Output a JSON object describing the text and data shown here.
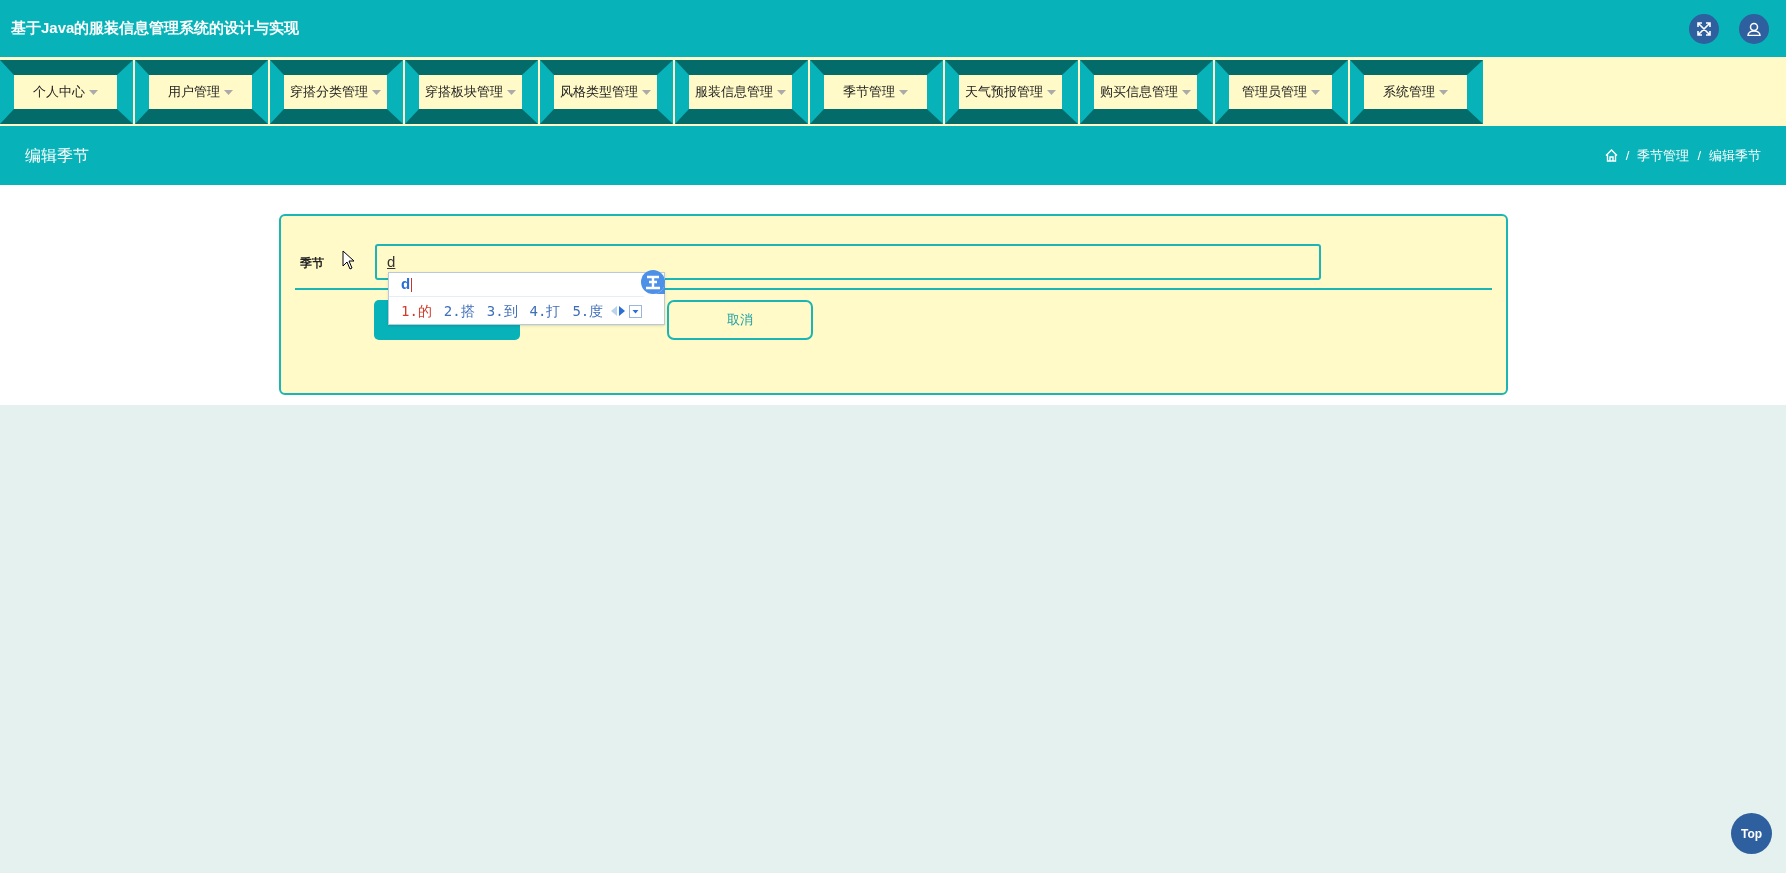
{
  "header": {
    "title": "基于Java的服装信息管理系统的设计与实现"
  },
  "nav": [
    {
      "label": "个人中心"
    },
    {
      "label": "用户管理"
    },
    {
      "label": "穿搭分类管理"
    },
    {
      "label": "穿搭板块管理"
    },
    {
      "label": "风格类型管理"
    },
    {
      "label": "服装信息管理"
    },
    {
      "label": "季节管理"
    },
    {
      "label": "天气预报管理"
    },
    {
      "label": "购买信息管理"
    },
    {
      "label": "管理员管理"
    },
    {
      "label": "系统管理"
    }
  ],
  "page_header": {
    "title": "编辑季节",
    "breadcrumb": [
      "季节管理",
      "编辑季节"
    ],
    "separator": "/"
  },
  "form": {
    "fields": [
      {
        "label": "季节",
        "value": "d"
      }
    ],
    "buttons": [
      {
        "kind": "submit"
      },
      {
        "kind": "cancel",
        "label": "取消"
      }
    ]
  },
  "ime": {
    "composition": "d",
    "candidates": [
      {
        "label": "1.的",
        "selected": true
      },
      {
        "label": "2.搭",
        "selected": false
      },
      {
        "label": "3.到",
        "selected": false
      },
      {
        "label": "4.打",
        "selected": false
      },
      {
        "label": "5.度",
        "selected": false
      }
    ]
  },
  "back_to_top": "Top"
}
